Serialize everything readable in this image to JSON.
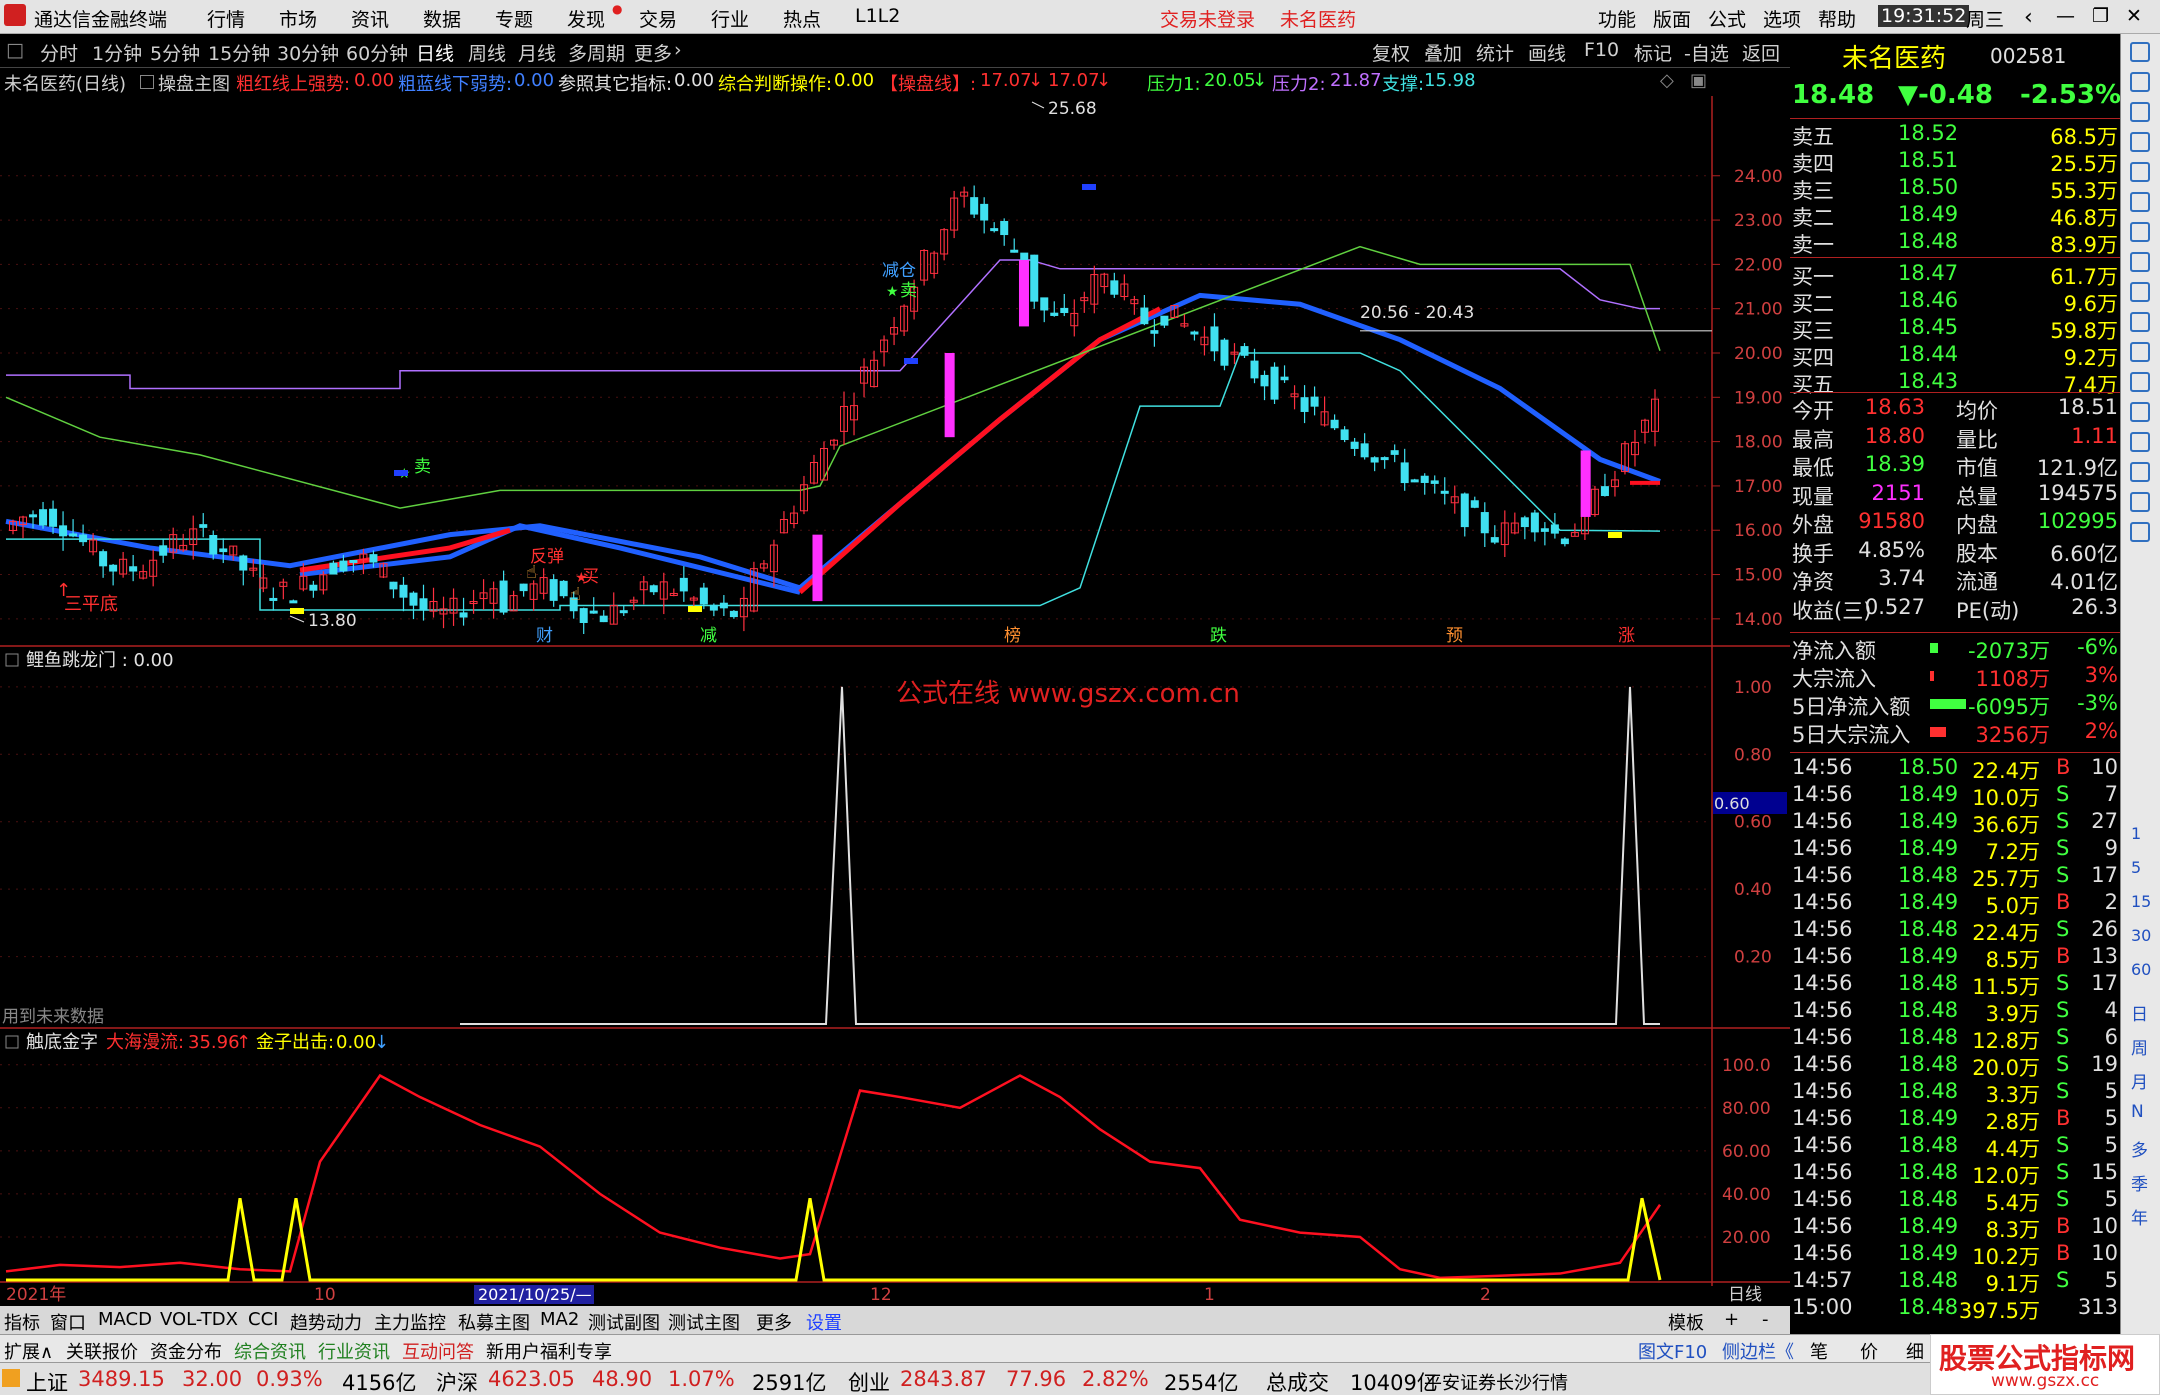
{
  "menubar": {
    "app_title": "通达信金融终端",
    "items": [
      "行情",
      "市场",
      "资讯",
      "数据",
      "专题",
      "发现",
      "交易",
      "行业",
      "热点",
      "L1L2"
    ],
    "login_status": "交易未登录",
    "stock_name": "未名医药",
    "right_items": [
      "功能",
      "版面",
      "公式",
      "选项",
      "帮助"
    ],
    "time": "19:31:52",
    "weekday": "周三"
  },
  "toolbar": {
    "periods": [
      "分时",
      "1分钟",
      "5分钟",
      "15分钟",
      "30分钟",
      "60分钟",
      "日线",
      "周线",
      "月线",
      "多周期",
      "更多"
    ],
    "active": "日线",
    "right": [
      "复权",
      "叠加",
      "统计",
      "画线",
      "F10",
      "标记",
      "-自选",
      "返回"
    ]
  },
  "info": {
    "title": "未名医药(日线)",
    "main": "操盘主图",
    "s1_label": "粗红线上强势:",
    "s1_val": "0.00",
    "s2_label": "粗蓝线下弱势:",
    "s2_val": "0.00",
    "s3_label": "参照其它指标:",
    "s3_val": "0.00",
    "s4_label": "综合判断操作:",
    "s4_val": "0.00",
    "s5_label": "【操盘线】:",
    "s5_val": "17.07",
    "s6_val": "17.07",
    "p1_label": "压力1:",
    "p1_val": "20.05",
    "p2_label": "压力2:",
    "p2_val": "21.87",
    "sup_label": "支撑:",
    "sup_val": "15.98"
  },
  "chart_data": [
    {
      "type": "candlestick",
      "panel": "main",
      "ylim": [
        13.5,
        25.8
      ],
      "y_ticks": [
        "24.00",
        "23.00",
        "22.00",
        "21.00",
        "20.00",
        "19.00",
        "18.00",
        "17.00",
        "16.00",
        "15.00",
        "14.00"
      ],
      "annotations": {
        "high": "25.68",
        "low": "13.80",
        "range": "20.56 - 20.43",
        "buy1": "卖",
        "buy2": "卖",
        "reduce": "减仓",
        "rebound": "反弹",
        "buy3": "买",
        "sanping": "三平底"
      },
      "event_labels": [
        "财",
        "减",
        "榜",
        "跌",
        "预",
        "涨"
      ]
    },
    {
      "type": "line",
      "panel": "sub1",
      "title": "鲤鱼跳龙门 : 0.00",
      "ylim": [
        0,
        1.05
      ],
      "y_ticks": [
        "1.00",
        "0.80",
        "0.60",
        "0.40",
        "0.20"
      ],
      "marker": "0.60",
      "note": "用到未来数据",
      "watermark": "公式在线  www.gszx.com.cn"
    },
    {
      "type": "line",
      "panel": "sub2",
      "title": "触底金字",
      "s1_label": "大海漫流:",
      "s1_val": "35.96",
      "s2_label": "金子出击:",
      "s2_val": "0.00",
      "ylim": [
        0,
        105
      ],
      "y_ticks": [
        "100.0",
        "80.00",
        "60.00",
        "40.00",
        "20.00"
      ]
    }
  ],
  "xaxis": {
    "labels": [
      "2021年",
      "10",
      "2021/10/25/—",
      "12",
      "1",
      "2"
    ],
    "period": "日线"
  },
  "quote": {
    "name": "未名医药",
    "code": "002581",
    "price": "18.48",
    "change": "▼-0.48",
    "pct": "-2.53%",
    "asks": [
      [
        "卖五",
        "18.52",
        "68.5万"
      ],
      [
        "卖四",
        "18.51",
        "25.5万"
      ],
      [
        "卖三",
        "18.50",
        "55.3万"
      ],
      [
        "卖二",
        "18.49",
        "46.8万"
      ],
      [
        "卖一",
        "18.48",
        "83.9万"
      ]
    ],
    "bids": [
      [
        "买一",
        "18.47",
        "61.7万"
      ],
      [
        "买二",
        "18.46",
        "9.6万"
      ],
      [
        "买三",
        "18.45",
        "59.8万"
      ],
      [
        "买四",
        "18.44",
        "9.2万"
      ],
      [
        "买五",
        "18.43",
        "7.4万"
      ]
    ],
    "stats": [
      [
        "今开",
        "18.63",
        "均价",
        "18.51"
      ],
      [
        "最高",
        "18.80",
        "量比",
        "1.11"
      ],
      [
        "最低",
        "18.39",
        "市值",
        "121.9亿"
      ],
      [
        "现量",
        "2151",
        "总量",
        "194575"
      ],
      [
        "外盘",
        "91580",
        "内盘",
        "102995"
      ],
      [
        "换手",
        "4.85%",
        "股本",
        "6.60亿"
      ],
      [
        "净资",
        "3.74",
        "流通",
        "4.01亿"
      ],
      [
        "收益(三)",
        "0.527",
        "PE(动)",
        "26.3"
      ]
    ],
    "flows": [
      [
        "净流入额",
        "-2073万",
        "-6%"
      ],
      [
        "大宗流入",
        "1108万",
        "3%"
      ],
      [
        "5日净流入额",
        "-6095万",
        "-3%"
      ],
      [
        "5日大宗流入",
        "3256万",
        "2%"
      ]
    ],
    "ticks": [
      [
        "14:56",
        "18.50",
        "22.4万",
        "B",
        "10"
      ],
      [
        "14:56",
        "18.49",
        "10.0万",
        "S",
        "7"
      ],
      [
        "14:56",
        "18.49",
        "36.6万",
        "S",
        "27"
      ],
      [
        "14:56",
        "18.49",
        "7.2万",
        "S",
        "9"
      ],
      [
        "14:56",
        "18.48",
        "25.7万",
        "S",
        "17"
      ],
      [
        "14:56",
        "18.49",
        "5.0万",
        "B",
        "2"
      ],
      [
        "14:56",
        "18.48",
        "22.4万",
        "S",
        "26"
      ],
      [
        "14:56",
        "18.49",
        "8.5万",
        "B",
        "13"
      ],
      [
        "14:56",
        "18.48",
        "11.5万",
        "S",
        "17"
      ],
      [
        "14:56",
        "18.48",
        "3.9万",
        "S",
        "4"
      ],
      [
        "14:56",
        "18.48",
        "12.8万",
        "S",
        "6"
      ],
      [
        "14:56",
        "18.48",
        "20.0万",
        "S",
        "19"
      ],
      [
        "14:56",
        "18.48",
        "3.3万",
        "S",
        "5"
      ],
      [
        "14:56",
        "18.49",
        "2.8万",
        "B",
        "5"
      ],
      [
        "14:56",
        "18.48",
        "4.4万",
        "S",
        "5"
      ],
      [
        "14:56",
        "18.48",
        "12.0万",
        "S",
        "15"
      ],
      [
        "14:56",
        "18.48",
        "5.4万",
        "S",
        "5"
      ],
      [
        "14:56",
        "18.49",
        "8.3万",
        "B",
        "10"
      ],
      [
        "14:56",
        "18.49",
        "10.2万",
        "B",
        "10"
      ],
      [
        "14:57",
        "18.48",
        "9.1万",
        "S",
        "5"
      ],
      [
        "15:00",
        "18.48",
        "397.5万",
        "",
        "313"
      ]
    ]
  },
  "bottom_tabs": [
    "指标",
    "窗口",
    "MACD",
    "VOL-TDX",
    "CCI",
    "趋势动力",
    "主力监控",
    "私募主图",
    "MA2",
    "测试副图",
    "测试主图",
    "更多",
    "设置"
  ],
  "bottom_right": [
    "模板",
    "+",
    "-"
  ],
  "bottom_tabs2": [
    "扩展∧",
    "关联报价",
    "资金分布",
    "综合资讯",
    "行业资讯",
    "互动问答",
    "新用户福利专享"
  ],
  "bottom_right2": [
    "图文F10",
    "侧边栏《",
    "笔",
    "价",
    "细"
  ],
  "status": {
    "sh_label": "上证",
    "sh": "3489.15",
    "sh_chg": "32.00",
    "sh_pct": "0.93%",
    "sh_amt": "4156亿",
    "sz_label": "沪深",
    "sz": "4623.05",
    "sz_chg": "48.90",
    "sz_pct": "1.07%",
    "sz_amt": "2591亿",
    "cy_label": "创业",
    "cy": "2843.87",
    "cy_chg": "77.96",
    "cy_pct": "2.82%",
    "cy_amt": "2554亿",
    "total_label": "总成交",
    "total": "10409亿",
    "broker": "平安证券长沙行情"
  },
  "side_tools": [
    "日",
    "周",
    "月",
    "N",
    "多",
    "季",
    "年"
  ],
  "logo_text": "股票公式指标网",
  "logo_url": "www.gszx.cc"
}
